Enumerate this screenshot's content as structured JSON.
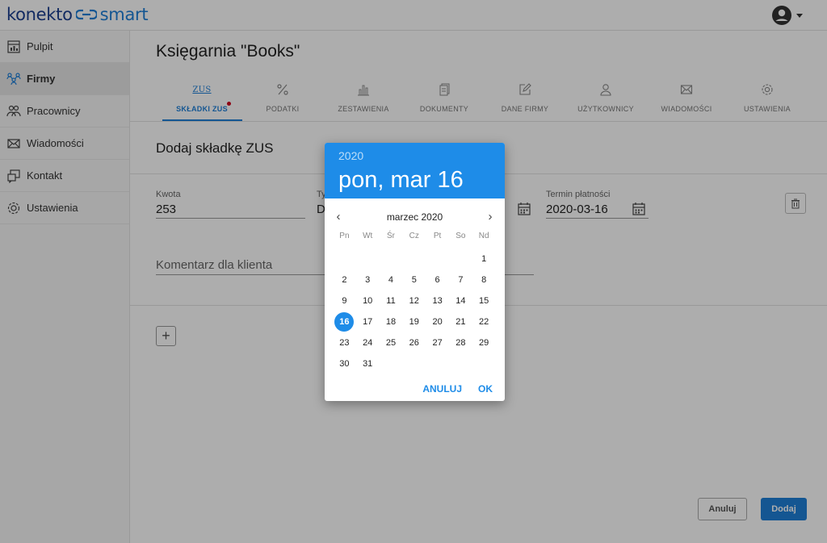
{
  "app": {
    "logo_a": "konekto",
    "logo_b": "smart"
  },
  "sidebar": {
    "items": [
      {
        "label": "Pulpit",
        "icon": "dashboard-icon"
      },
      {
        "label": "Firmy",
        "icon": "companies-icon",
        "active": true
      },
      {
        "label": "Pracownicy",
        "icon": "employees-icon"
      },
      {
        "label": "Wiadomości",
        "icon": "mail-icon"
      },
      {
        "label": "Kontakt",
        "icon": "contact-icon"
      },
      {
        "label": "Ustawienia",
        "icon": "gear-icon"
      }
    ]
  },
  "page": {
    "title": "Księgarnia \"Books\""
  },
  "tabs": [
    {
      "label": "SKŁADKI ZUS",
      "icon_text": "ZUS",
      "active": true,
      "badge": true
    },
    {
      "label": "PODATKI",
      "icon": "percent-icon"
    },
    {
      "label": "ZESTAWIENIA",
      "icon": "bar-chart-icon"
    },
    {
      "label": "DOKUMENTY",
      "icon": "documents-icon"
    },
    {
      "label": "DANE FIRMY",
      "icon": "edit-icon"
    },
    {
      "label": "UŻYTKOWNICY",
      "icon": "user-icon"
    },
    {
      "label": "WIADOMOŚCI",
      "icon": "envelope-icon"
    },
    {
      "label": "USTAWIENIA",
      "icon": "gear-icon"
    }
  ],
  "form": {
    "section_title": "Dodaj składkę ZUS",
    "amount_label": "Kwota",
    "amount_value": "253",
    "type_label_partial": "Ty",
    "type_value_partial": "D",
    "due_label": "Termin płatności",
    "due_value": "2020-03-16",
    "comment_placeholder": "Komentarz dla klienta",
    "add_row_symbol": "+",
    "cancel_label": "Anuluj",
    "submit_label": "Dodaj"
  },
  "datepicker": {
    "year": "2020",
    "selected_date": "pon, mar 16",
    "month_label": "marzec 2020",
    "prev_symbol": "‹",
    "next_symbol": "›",
    "weekdays": [
      "Pn",
      "Wt",
      "Śr",
      "Cz",
      "Pt",
      "So",
      "Nd"
    ],
    "weeks": [
      [
        "",
        "",
        "",
        "",
        "",
        "",
        "1"
      ],
      [
        "2",
        "3",
        "4",
        "5",
        "6",
        "7",
        "8"
      ],
      [
        "9",
        "10",
        "11",
        "12",
        "13",
        "14",
        "15"
      ],
      [
        "16",
        "17",
        "18",
        "19",
        "20",
        "21",
        "22"
      ],
      [
        "23",
        "24",
        "25",
        "26",
        "27",
        "28",
        "29"
      ],
      [
        "30",
        "31",
        "",
        "",
        "",
        "",
        ""
      ]
    ],
    "selected_day": "16",
    "cancel_label": "ANULUJ",
    "ok_label": "OK"
  },
  "colors": {
    "accent": "#1e7fd8",
    "picker_header": "#1e8ce8",
    "badge": "#d0021b"
  }
}
